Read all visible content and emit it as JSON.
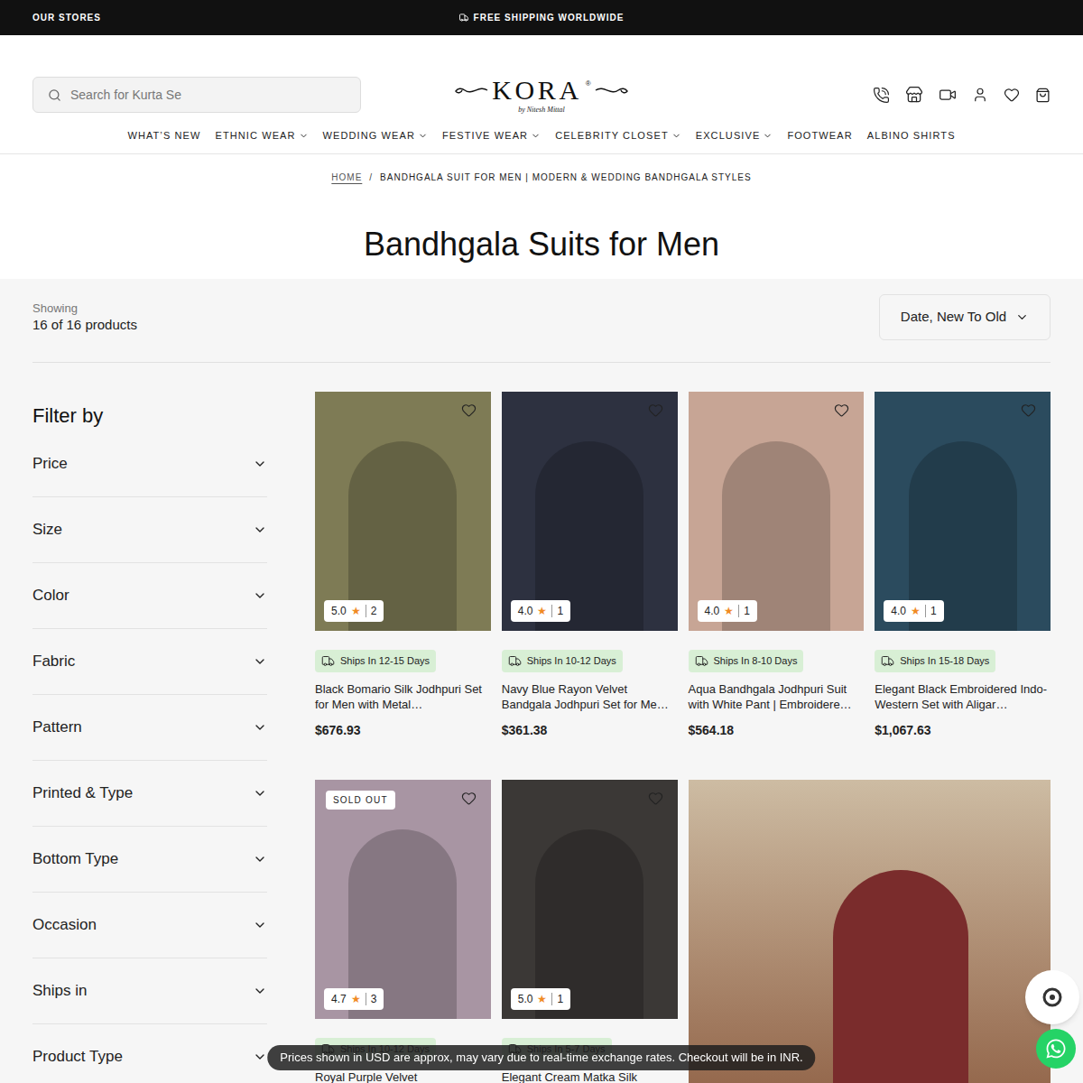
{
  "top_bar": {
    "left": "OUR STORES",
    "center": "FREE SHIPPING WORLDWIDE"
  },
  "search": {
    "placeholder": "Search for Kurta Se"
  },
  "logo": {
    "text": "KORA",
    "mark": "®",
    "tagline": "by Nitesh Mittal"
  },
  "nav": [
    {
      "label": "WHAT’S NEW",
      "dropdown": false
    },
    {
      "label": "ETHNIC WEAR",
      "dropdown": true
    },
    {
      "label": "WEDDING WEAR",
      "dropdown": true
    },
    {
      "label": "FESTIVE WEAR",
      "dropdown": true
    },
    {
      "label": "CELEBRITY CLOSET",
      "dropdown": true
    },
    {
      "label": "EXCLUSIVE",
      "dropdown": true
    },
    {
      "label": "FOOTWEAR",
      "dropdown": false
    },
    {
      "label": "ALBINO SHIRTS",
      "dropdown": false
    }
  ],
  "breadcrumb": {
    "separator": "/",
    "items": [
      {
        "label": "HOME",
        "current": false
      },
      {
        "label": "BANDHGALA SUIT FOR MEN | MODERN & WEDDING BANDHGALA STYLES",
        "current": true
      }
    ]
  },
  "page_title": "Bandhgala Suits for Men",
  "results": {
    "label": "Showing",
    "count": "16 of 16 products"
  },
  "sort": {
    "value": "Date, New To Old"
  },
  "filters": {
    "title": "Filter by",
    "items": [
      {
        "label": "Price",
        "expanded": false
      },
      {
        "label": "Size",
        "expanded": false
      },
      {
        "label": "Color",
        "expanded": false
      },
      {
        "label": "Fabric",
        "expanded": false
      },
      {
        "label": "Pattern",
        "expanded": false
      },
      {
        "label": "Printed & Type",
        "expanded": false
      },
      {
        "label": "Bottom Type",
        "expanded": false
      },
      {
        "label": "Occasion",
        "expanded": false
      },
      {
        "label": "Ships in",
        "expanded": false
      },
      {
        "label": "Product Type",
        "expanded": false
      }
    ]
  },
  "rating_star": "★",
  "sold_out_label": "SOLD OUT",
  "products": [
    {
      "title": "Black Bomario Silk Jodhpuri Set for Men with Metal…",
      "price": "$676.93",
      "rating": "5.0",
      "reviews": "2",
      "ships": "Ships In 12-15 Days",
      "sold_out": false
    },
    {
      "title": "Navy Blue Rayon Velvet Bandgala Jodhpuri Set for Me…",
      "price": "$361.38",
      "rating": "4.0",
      "reviews": "1",
      "ships": "Ships In 10-12 Days",
      "sold_out": false
    },
    {
      "title": "Aqua Bandhgala Jodhpuri Suit with White Pant | Embroidere…",
      "price": "$564.18",
      "rating": "4.0",
      "reviews": "1",
      "ships": "Ships In 8-10 Days",
      "sold_out": false
    },
    {
      "title": "Elegant Black Embroidered Indo-Western Set with Aligar…",
      "price": "$1,067.63",
      "rating": "4.0",
      "reviews": "1",
      "ships": "Ships In 15-18 Days",
      "sold_out": false
    },
    {
      "title": "Royal Purple Velvet",
      "rating": "4.7",
      "reviews": "3",
      "ships": "Ships In 10-12 Days",
      "sold_out": true
    },
    {
      "title": "Elegant Cream Matka Silk",
      "rating": "5.0",
      "reviews": "1",
      "ships": "Ships In 5-7 Days",
      "sold_out": false
    }
  ],
  "notice": "Prices shown in USD are approx, may vary due to real-time exchange rates. Checkout will be in INR."
}
